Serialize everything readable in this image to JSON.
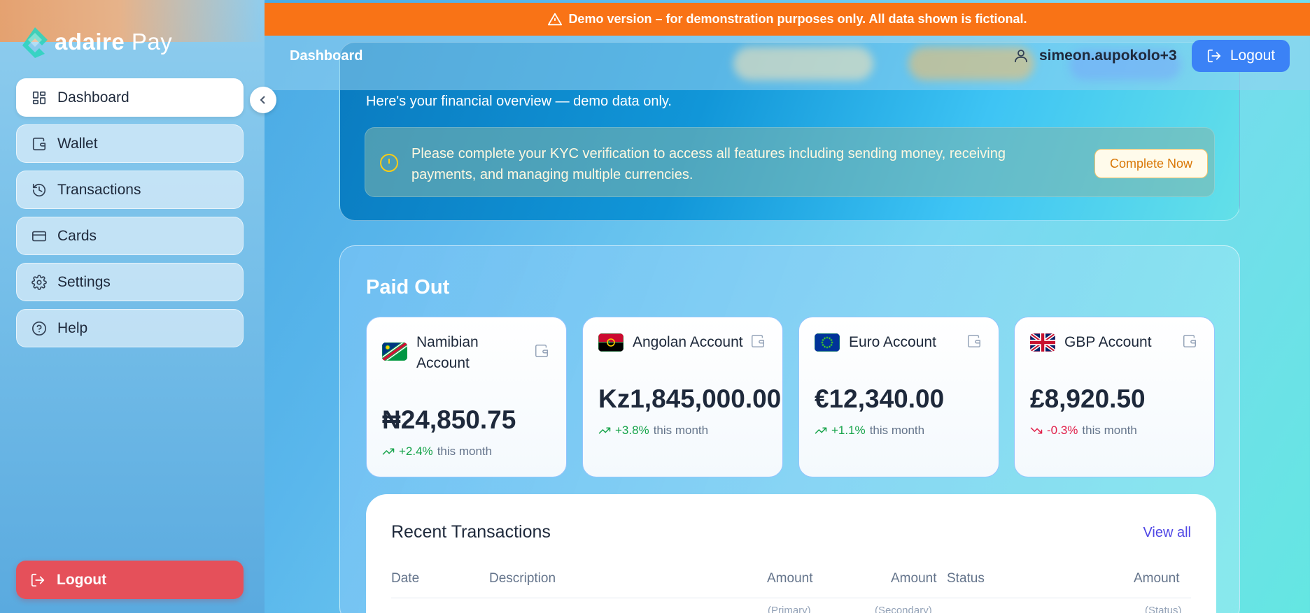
{
  "brand": {
    "name_bold": "adaire",
    "name_light": "Pay",
    "accent_color": "#2dd4bf"
  },
  "sidebar": {
    "items": [
      {
        "label": "Dashboard",
        "icon": "dashboard-grid-icon",
        "active": true
      },
      {
        "label": "Wallet",
        "icon": "wallet-icon",
        "active": false
      },
      {
        "label": "Transactions",
        "icon": "history-icon",
        "active": false
      },
      {
        "label": "Cards",
        "icon": "credit-card-icon",
        "active": false
      },
      {
        "label": "Settings",
        "icon": "gear-icon",
        "active": false
      },
      {
        "label": "Help",
        "icon": "help-circle-icon",
        "active": false
      }
    ],
    "logout_label": "Logout",
    "logout_color": "#e5505a"
  },
  "banner": {
    "text": "Demo version – for demonstration purposes only. All data shown is fictional.",
    "color": "#f97316"
  },
  "header": {
    "title": "Dashboard",
    "username": "simeon.aupokolo+3",
    "logout_label": "Logout",
    "logout_color": "#3b82f6"
  },
  "welcome": {
    "subtitle": "Here's your financial overview — demo data only.",
    "kyc_message": "Please complete your KYC verification to access all features including sending money, receiving payments, and managing multiple currencies.",
    "kyc_button": "Complete Now"
  },
  "paid_out": {
    "title": "Paid Out",
    "accounts": [
      {
        "name": "Namibian Account",
        "balance": "₦24,850.75",
        "change": "+2.4%",
        "period": "this month",
        "trend": "up",
        "flag": "namibia-flag"
      },
      {
        "name": "Angolan Account",
        "balance": "Kz1,845,000.00",
        "change": "+3.8%",
        "period": "this month",
        "trend": "up",
        "flag": "angola-flag"
      },
      {
        "name": "Euro Account",
        "balance": "€12,340.00",
        "change": "+1.1%",
        "period": "this month",
        "trend": "up",
        "flag": "eu-flag"
      },
      {
        "name": "GBP Account",
        "balance": "£8,920.50",
        "change": "-0.3%",
        "period": "this month",
        "trend": "down",
        "flag": "uk-flag"
      }
    ]
  },
  "recent_transactions": {
    "title": "Recent Transactions",
    "view_all": "View all",
    "columns": {
      "date": "Date",
      "description": "Description",
      "amount_primary": "Amount",
      "amount_primary_sub": "(Primary)",
      "amount_secondary": "Amount",
      "amount_secondary_sub": "(Secondary)",
      "status": "Status",
      "amount_status": "Amount",
      "amount_status_sub": "(Status)"
    }
  }
}
